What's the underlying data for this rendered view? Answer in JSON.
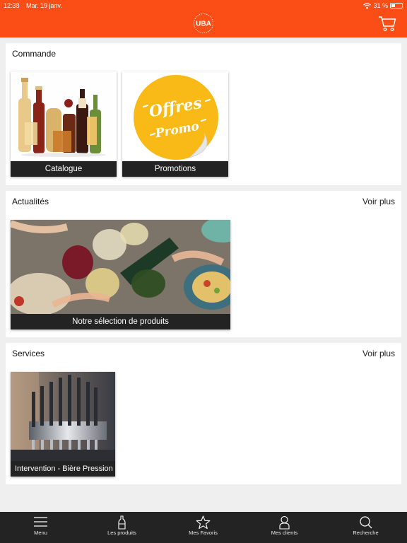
{
  "status_bar": {
    "time": "12:38",
    "date": "Mar. 19 janv.",
    "battery": "31 %",
    "battery_fraction": 0.31
  },
  "header": {
    "logo_text": "UBA",
    "logo_icon": "uba-logo",
    "cart_icon": "cart-icon",
    "brand_color": "#fb4d16"
  },
  "sections": {
    "commande": {
      "title": "Commande",
      "tiles": [
        {
          "label": "Catalogue"
        },
        {
          "label": "Promotions",
          "image_text_1": "Offres",
          "image_text_2": "Promo"
        }
      ]
    },
    "actualites": {
      "title": "Actualités",
      "more": "Voir plus",
      "tiles": [
        {
          "label": "Notre sélection de produits"
        }
      ]
    },
    "services": {
      "title": "Services",
      "more": "Voir plus",
      "tiles": [
        {
          "label": "Intervention - Bière Pression"
        }
      ]
    }
  },
  "tabbar": {
    "items": [
      {
        "label": "Menu",
        "icon": "menu-icon"
      },
      {
        "label": "Les produits",
        "icon": "bottle-icon"
      },
      {
        "label": "Mes Favoris",
        "icon": "star-icon"
      },
      {
        "label": "Mes clients",
        "icon": "user-icon"
      },
      {
        "label": "Recherche",
        "icon": "search-icon"
      }
    ]
  }
}
